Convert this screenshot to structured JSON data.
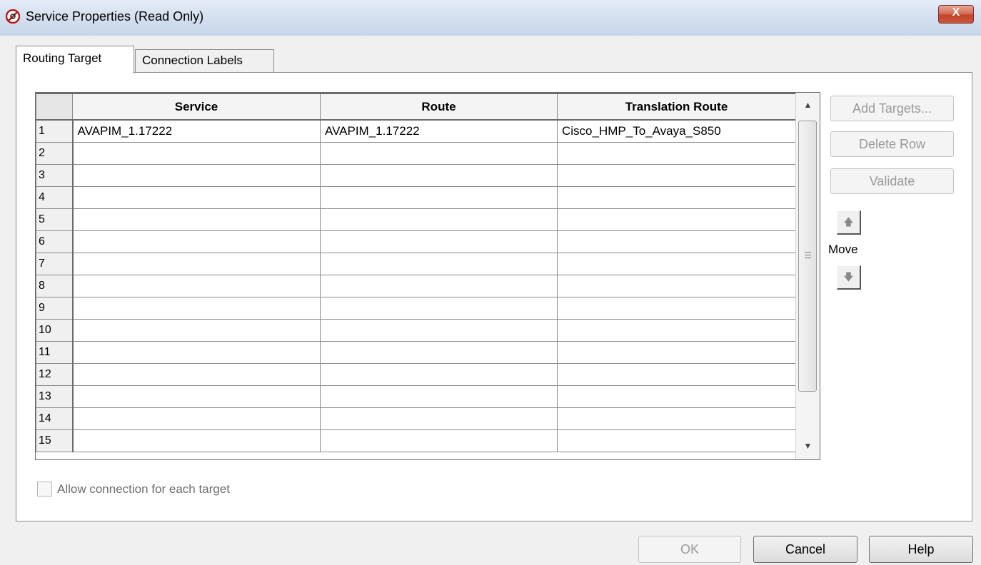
{
  "window": {
    "title": "Service Properties (Read Only)",
    "close_label": "X"
  },
  "tabs": [
    {
      "label": "Routing Target",
      "active": true
    },
    {
      "label": "Connection Labels",
      "active": false
    }
  ],
  "grid": {
    "columns": [
      "Service",
      "Route",
      "Translation Route"
    ],
    "rows": [
      {
        "num": "1",
        "service": "AVAPIM_1.17222",
        "route": "AVAPIM_1.17222",
        "translation_route": "Cisco_HMP_To_Avaya_S850"
      },
      {
        "num": "2",
        "service": "",
        "route": "",
        "translation_route": ""
      },
      {
        "num": "3",
        "service": "",
        "route": "",
        "translation_route": ""
      },
      {
        "num": "4",
        "service": "",
        "route": "",
        "translation_route": ""
      },
      {
        "num": "5",
        "service": "",
        "route": "",
        "translation_route": ""
      },
      {
        "num": "6",
        "service": "",
        "route": "",
        "translation_route": ""
      },
      {
        "num": "7",
        "service": "",
        "route": "",
        "translation_route": ""
      },
      {
        "num": "8",
        "service": "",
        "route": "",
        "translation_route": ""
      },
      {
        "num": "9",
        "service": "",
        "route": "",
        "translation_route": ""
      },
      {
        "num": "10",
        "service": "",
        "route": "",
        "translation_route": ""
      },
      {
        "num": "11",
        "service": "",
        "route": "",
        "translation_route": ""
      },
      {
        "num": "12",
        "service": "",
        "route": "",
        "translation_route": ""
      },
      {
        "num": "13",
        "service": "",
        "route": "",
        "translation_route": ""
      },
      {
        "num": "14",
        "service": "",
        "route": "",
        "translation_route": ""
      },
      {
        "num": "15",
        "service": "",
        "route": "",
        "translation_route": ""
      }
    ]
  },
  "side_buttons": {
    "add_targets": "Add Targets...",
    "delete_row": "Delete Row",
    "validate": "Validate",
    "move_label": "Move"
  },
  "checkbox": {
    "label": "Allow connection for each target",
    "checked": false
  },
  "footer": {
    "ok": "OK",
    "cancel": "Cancel",
    "help": "Help"
  },
  "colors": {
    "titlebar": "#d4e0ef",
    "close_button": "#c9563c",
    "disabled_text": "#9a9a9a"
  },
  "icons": {
    "app": "no-entry-app-icon",
    "scroll_up": "triangle-up",
    "scroll_down": "triangle-down",
    "move_up": "arrow-up",
    "move_down": "arrow-down"
  }
}
